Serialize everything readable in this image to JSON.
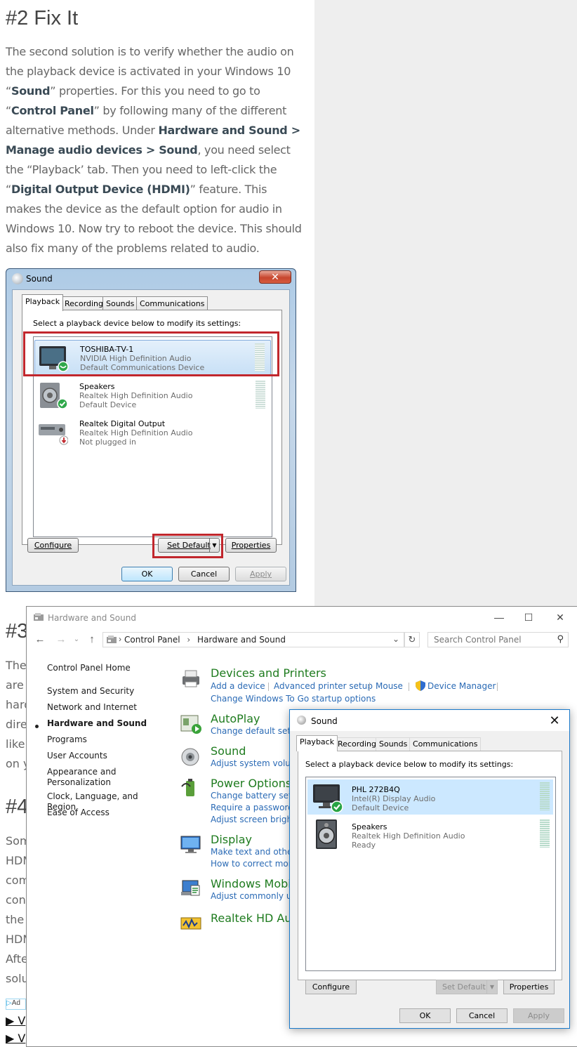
{
  "article": {
    "heading": "#2 Fix It",
    "p_parts": [
      "The second solution is to verify whether the audio on the playback device is activated in your Windows 10 “",
      "Sound",
      "” properties. For this you need to go to “",
      "Control Panel",
      "” by following many of the different alternative methods. Under ",
      "Hardware and Sound > Manage audio devices > Sound",
      ", you need select the “Playback’ tab. Then you need to left-click the “",
      "Digital Output Device (HDMI)",
      "” feature. This makes the device as the default option for audio in Windows 10. Now try to reboot the device. This should also fix many of the problems related to audio."
    ],
    "peek_h3": "#3",
    "peek_h4": "#4",
    "peek_lines_3": [
      "The",
      "are",
      "hard",
      "direc",
      "like",
      "on y"
    ],
    "peek_lines_4": [
      "Som",
      "HDM",
      "com",
      "conn",
      "the r",
      "HDM",
      "Afte",
      "solu"
    ],
    "peek_ad": "Ad",
    "peek_links": [
      "▶ V",
      "▶ V"
    ]
  },
  "win7_dialog": {
    "title": "Sound",
    "close": "✕",
    "tabs": [
      "Playback",
      "Recording",
      "Sounds",
      "Communications"
    ],
    "instruction": "Select a playback device below to modify its settings:",
    "devices": [
      {
        "name": "TOSHIBA-TV-1",
        "driver": "NVIDIA High Definition Audio",
        "status": "Default Communications Device"
      },
      {
        "name": "Speakers",
        "driver": "Realtek High Definition Audio",
        "status": "Default Device"
      },
      {
        "name": "Realtek Digital Output",
        "driver": "Realtek High Definition Audio",
        "status": "Not plugged in"
      }
    ],
    "configure": "Configure",
    "set_default": "Set Default",
    "properties": "Properties",
    "ok": "OK",
    "cancel": "Cancel",
    "apply": "Apply"
  },
  "control_panel": {
    "title": "Hardware and Sound",
    "breadcrumb": [
      "Control Panel",
      "Hardware and Sound"
    ],
    "breadcrumb_sep": "›",
    "search_placeholder": "Search Control Panel",
    "sidebar": [
      "Control Panel Home",
      "System and Security",
      "Network and Internet",
      "Hardware and Sound",
      "Programs",
      "User Accounts",
      "Appearance and Personalization",
      "Clock, Language, and Region",
      "Ease of Access"
    ],
    "categories": [
      {
        "title": "Devices and Printers",
        "links": [
          "Add a device",
          "Advanced printer setup",
          "Mouse",
          "Device Manager",
          "Change Windows To Go startup options"
        ]
      },
      {
        "title": "AutoPlay",
        "links": [
          "Change default settin"
        ]
      },
      {
        "title": "Sound",
        "links": [
          "Adjust system volum"
        ]
      },
      {
        "title": "Power Options",
        "links": [
          "Change battery settin",
          "Require a password w",
          "Adjust screen brightn"
        ]
      },
      {
        "title": "Display",
        "links": [
          "Make text and other i",
          "How to correct monit"
        ]
      },
      {
        "title": "Windows Mobili",
        "links": [
          "Adjust commonly use"
        ]
      },
      {
        "title": "Realtek HD Audi",
        "links": []
      }
    ]
  },
  "win10_dialog": {
    "title": "Sound",
    "close": "✕",
    "tabs": [
      "Playback",
      "Recording",
      "Sounds",
      "Communications"
    ],
    "instruction": "Select a playback device below to modify its settings:",
    "devices": [
      {
        "name": "PHL 272B4Q",
        "driver": "Intel(R) Display Audio",
        "status": "Default Device"
      },
      {
        "name": "Speakers",
        "driver": "Realtek High Definition Audio",
        "status": "Ready"
      }
    ],
    "configure": "Configure",
    "set_default": "Set Default",
    "properties": "Properties",
    "ok": "OK",
    "cancel": "Cancel",
    "apply": "Apply"
  }
}
